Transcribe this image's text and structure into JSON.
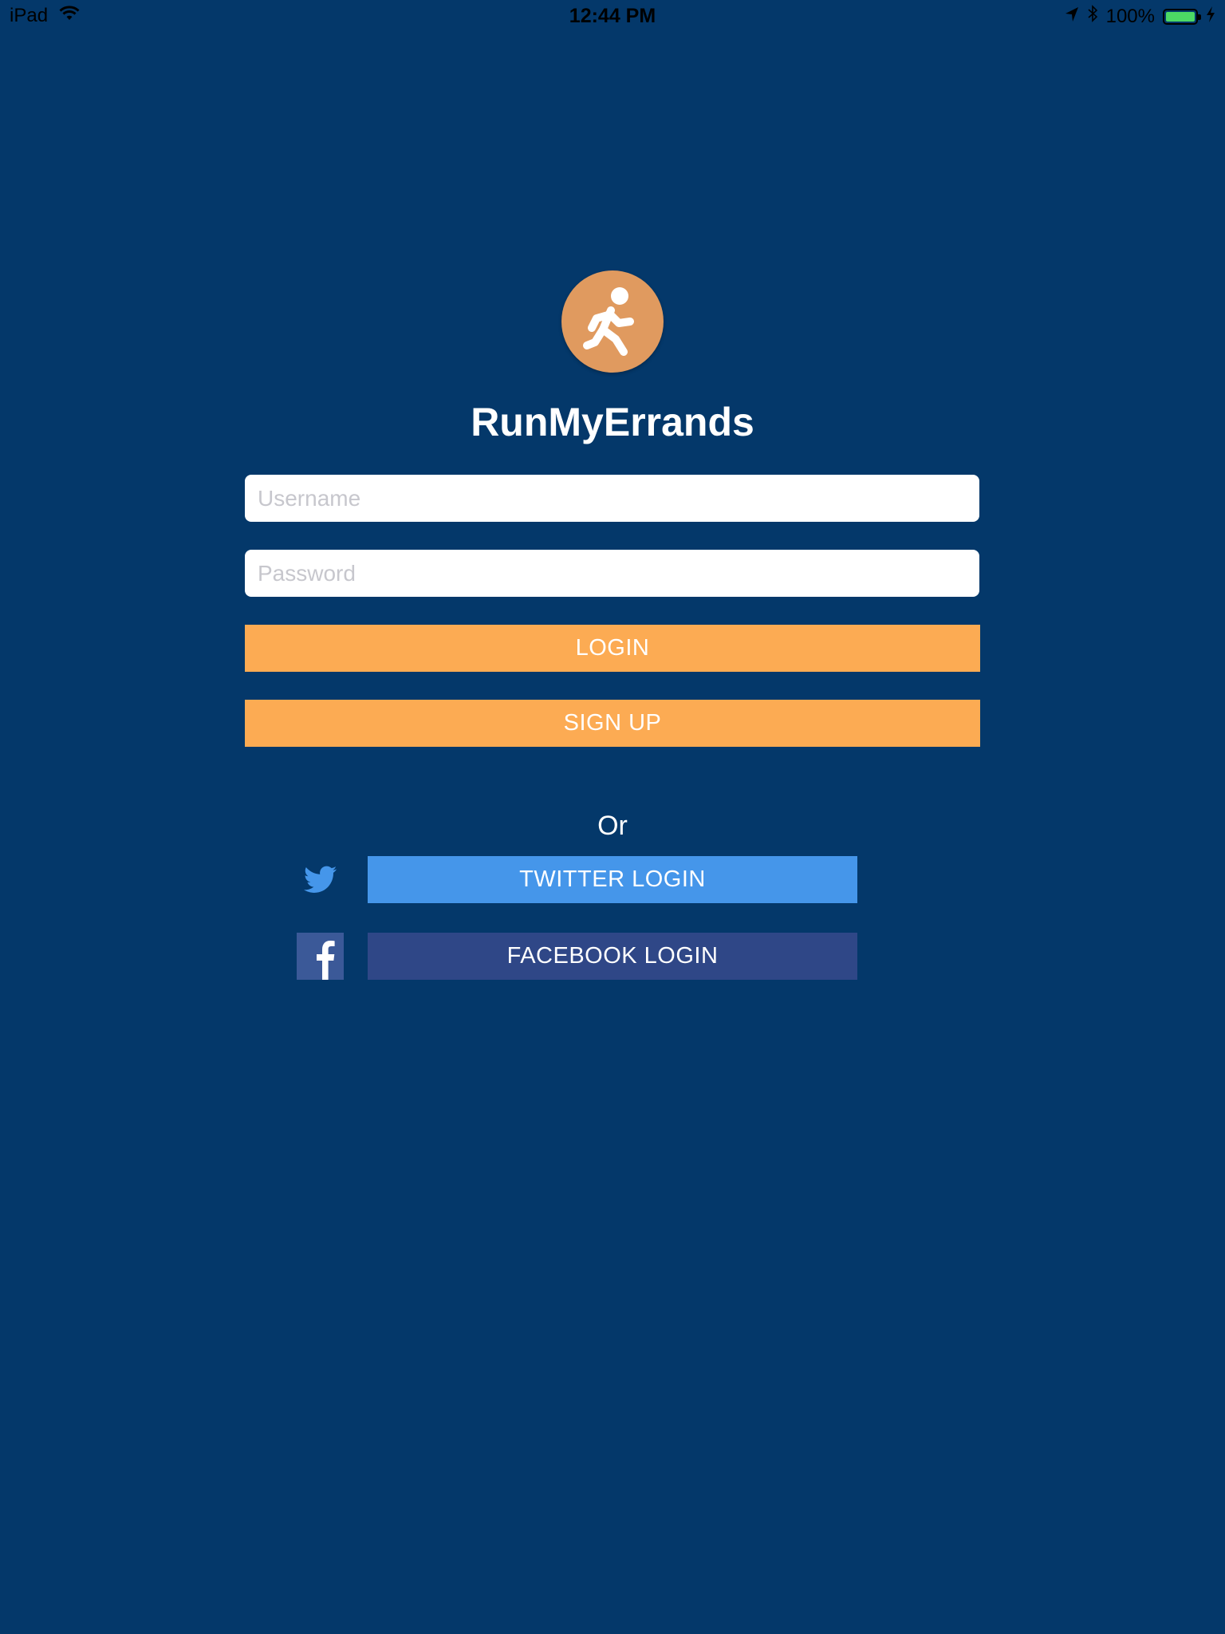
{
  "status_bar": {
    "device": "iPad",
    "time": "12:44 PM",
    "battery": "100%"
  },
  "app": {
    "title": "RunMyErrands",
    "logo_icon": "running-person-icon",
    "logo_color": "#e09a5f"
  },
  "form": {
    "username_placeholder": "Username",
    "username_value": "",
    "password_placeholder": "Password",
    "password_value": "",
    "login_label": "LOGIN",
    "signup_label": "SIGN UP"
  },
  "divider": {
    "or_label": "Or"
  },
  "social": {
    "twitter_label": "TWITTER LOGIN",
    "facebook_label": "FACEBOOK LOGIN",
    "twitter_icon": "twitter-bird-icon",
    "facebook_icon": "facebook-f-icon"
  },
  "colors": {
    "background": "#04386a",
    "accent_orange": "#fcab53",
    "twitter_blue": "#4596ea",
    "facebook_blue": "#2f4787",
    "battery_green": "#4cd964"
  }
}
